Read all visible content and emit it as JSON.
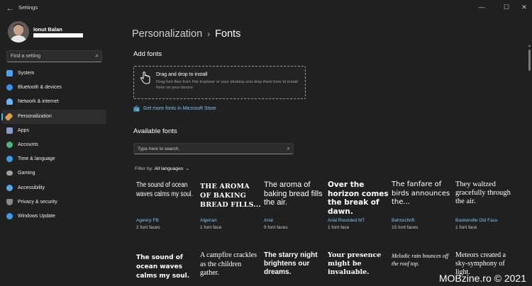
{
  "window": {
    "title": "Settings",
    "controls": {
      "minimize": "—",
      "maximize": "☐",
      "close": "✕"
    }
  },
  "profile": {
    "name": "Ionut Balan"
  },
  "sidebar": {
    "search_placeholder": "Find a setting",
    "items": [
      {
        "label": "System",
        "icon": "system-icon",
        "color": "#4aa3f0"
      },
      {
        "label": "Bluetooth & devices",
        "icon": "bluetooth-icon",
        "color": "#3b8ff0"
      },
      {
        "label": "Network & internet",
        "icon": "network-icon",
        "color": "#6cb2ee"
      },
      {
        "label": "Personalization",
        "icon": "brush-icon",
        "color": "#e0a04a",
        "active": true
      },
      {
        "label": "Apps",
        "icon": "apps-icon",
        "color": "#8a9cc8"
      },
      {
        "label": "Accounts",
        "icon": "accounts-icon",
        "color": "#4fb37c"
      },
      {
        "label": "Time & language",
        "icon": "clock-globe-icon",
        "color": "#3c9be6"
      },
      {
        "label": "Gaming",
        "icon": "gamepad-icon",
        "color": "#a0a0a0"
      },
      {
        "label": "Accessibility",
        "icon": "accessibility-icon",
        "color": "#58a8f0"
      },
      {
        "label": "Privacy & security",
        "icon": "shield-icon",
        "color": "#8a8a8a"
      },
      {
        "label": "Windows Update",
        "icon": "update-icon",
        "color": "#3d9ae8"
      }
    ]
  },
  "breadcrumb": {
    "parent": "Personalization",
    "separator": "›",
    "current": "Fonts"
  },
  "add_fonts": {
    "heading": "Add fonts",
    "drop_title": "Drag and drop to install",
    "drop_desc": "Drag font files from File Explorer or your desktop and drop them here to install fonts on your device.",
    "store_link": "Get more fonts in Microsoft Store"
  },
  "available": {
    "heading": "Available fonts",
    "search_placeholder": "Type here to search.",
    "filter_label": "Filter by:",
    "filter_value": "All languages"
  },
  "fonts_row1": [
    {
      "sample": "The sound of ocean waves calms my soul.",
      "name": "Agency FB",
      "count": "2 font faces"
    },
    {
      "sample": "THE AROMA OF BAKING BREAD FILLS...",
      "name": "Algerian",
      "count": "1 font face"
    },
    {
      "sample": "The aroma of baking bread fills the air.",
      "name": "Arial",
      "count": "9 font faces"
    },
    {
      "sample": "Over the horizon comes the break of dawn.",
      "name": "Arial Rounded MT",
      "count": "1 font face"
    },
    {
      "sample": "The fanfare of birds announces the...",
      "name": "Bahnschrift",
      "count": "15 font faces"
    },
    {
      "sample": "They waltzed gracefully through the air.",
      "name": "Baskerville Old Face",
      "count": "1 font face"
    }
  ],
  "fonts_row2": [
    {
      "sample": "The sound of ocean waves calms my soul."
    },
    {
      "sample": "A campfire crackles as the children gather."
    },
    {
      "sample": "The starry night brightens our dreams."
    },
    {
      "sample": "Your presence might be invaluable."
    },
    {
      "sample": "Melodic rain bounces off the roof top."
    },
    {
      "sample": "Meteors created a sky-symphony of light."
    }
  ],
  "watermark": "MOBzine.ro © 2021"
}
